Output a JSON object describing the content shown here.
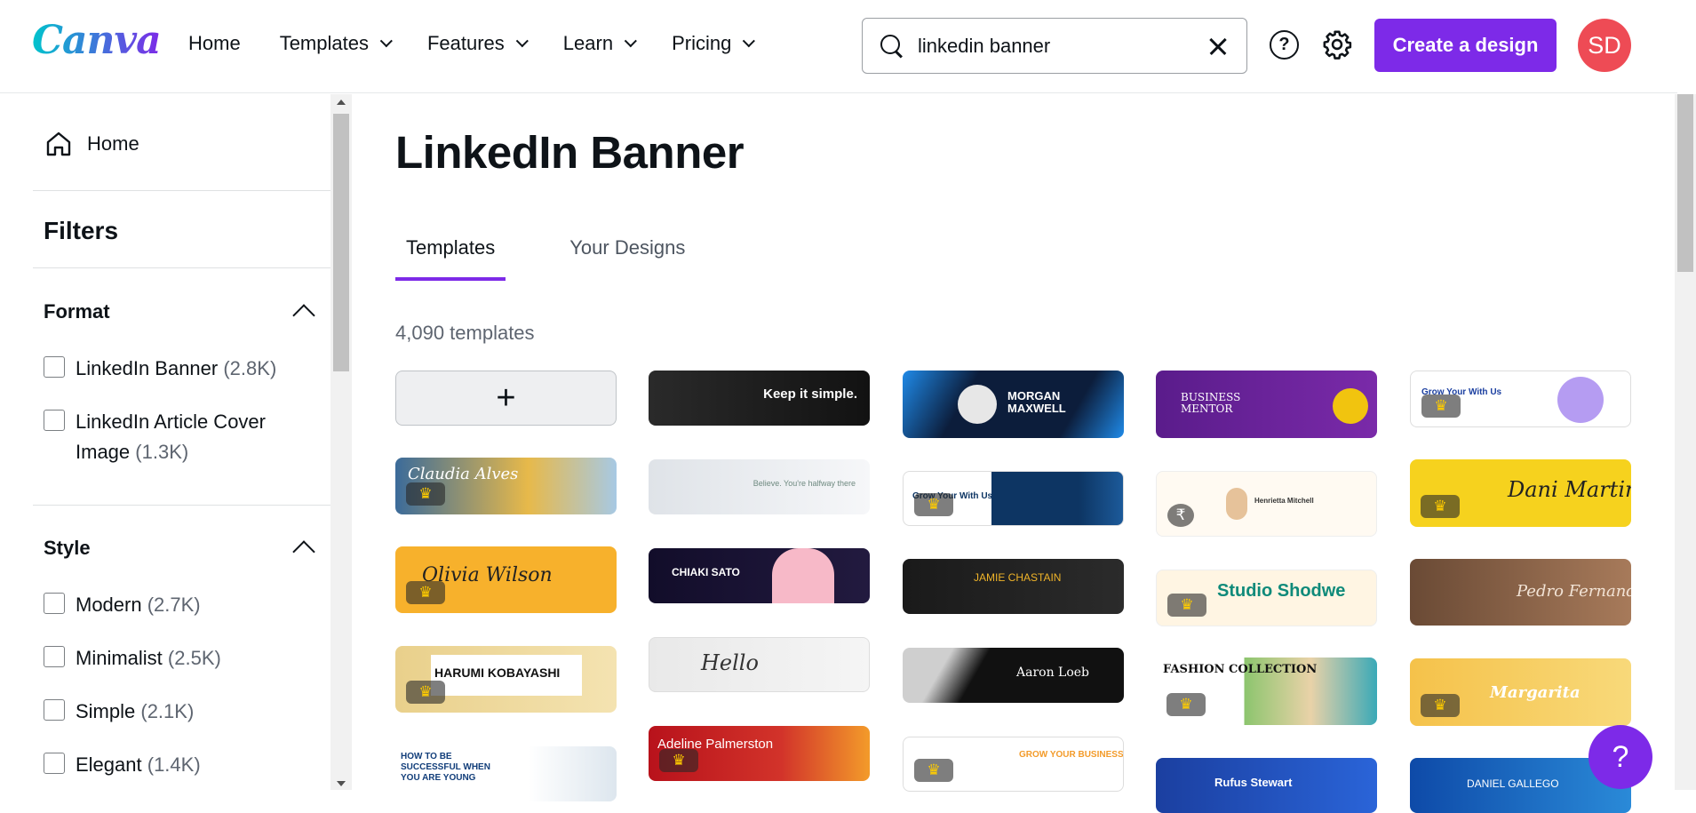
{
  "header": {
    "logo": "Canva",
    "nav": [
      "Home",
      "Templates",
      "Features",
      "Learn",
      "Pricing"
    ],
    "search_value": "linkedin banner",
    "create_label": "Create a design",
    "avatar_initials": "SD",
    "help_glyph": "?"
  },
  "sidebar": {
    "home_label": "Home",
    "filters_title": "Filters",
    "format": {
      "title": "Format",
      "items": [
        {
          "label": "LinkedIn Banner",
          "count": "(2.8K)"
        },
        {
          "label": "LinkedIn Article Cover",
          "label2": "Image",
          "count": "(1.3K)"
        }
      ]
    },
    "style": {
      "title": "Style",
      "items": [
        {
          "label": "Modern",
          "count": "(2.7K)"
        },
        {
          "label": "Minimalist",
          "count": "(2.5K)"
        },
        {
          "label": "Simple",
          "count": "(2.1K)"
        },
        {
          "label": "Elegant",
          "count": "(1.4K)"
        }
      ]
    }
  },
  "main": {
    "title": "LinkedIn Banner",
    "tabs": [
      "Templates",
      "Your Designs"
    ],
    "template_count": "4,090 templates",
    "add_glyph": "+",
    "tiles": [
      {
        "text": "Keep it simple."
      },
      {
        "text": "MORGAN MAXWELL"
      },
      {
        "text": "BUSINESS MENTOR"
      },
      {
        "text": "Grow Your With Us"
      },
      {
        "text": "Claudia Alves"
      },
      {
        "text": "Believe. You're halfway there"
      },
      {
        "text": "Grow Your With Us"
      },
      {
        "text": "Henrietta Mitchell"
      },
      {
        "text": "Dani Martinez"
      },
      {
        "text": "Olivia Wilson"
      },
      {
        "text": "CHIAKI SATO"
      },
      {
        "text": "JAMIE CHASTAIN"
      },
      {
        "text": "Studio Shodwe"
      },
      {
        "text": "Pedro Fernandes"
      },
      {
        "text": "HARUMI KOBAYASHI"
      },
      {
        "text": "Hello"
      },
      {
        "text": "Aaron Loeb"
      },
      {
        "text": "FASHION COLLECTION"
      },
      {
        "text": "Margarita"
      },
      {
        "text": "HOW TO BE SUCCESSFUL WHEN YOU ARE YOUNG"
      },
      {
        "text": "Adeline Palmerston"
      },
      {
        "text": "GROW YOUR BUSINESS"
      },
      {
        "text": "Rufus Stewart"
      },
      {
        "text": "DANIEL GALLEGO"
      }
    ]
  },
  "colors": {
    "brand_purple": "#7d2ae8",
    "avatar_red": "#ee4b55",
    "logo_teal": "#00c4cc"
  }
}
